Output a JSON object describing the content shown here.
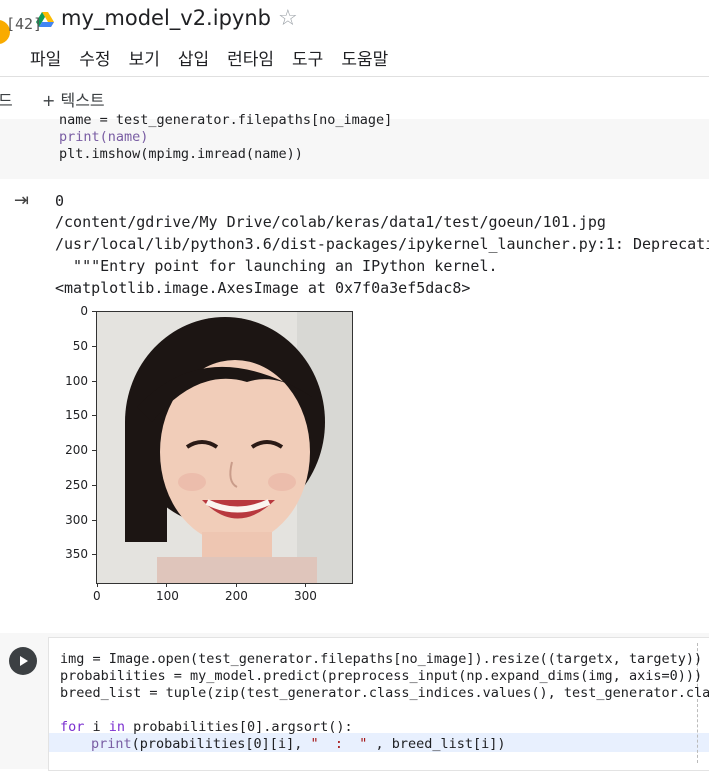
{
  "header": {
    "title": "my_model_v2.ipynb",
    "menu": [
      "파일",
      "수정",
      "보기",
      "삽입",
      "런타임",
      "도구",
      "도움말"
    ]
  },
  "toolbar": {
    "code_btn": "드",
    "text_btn": "+ 텍스트"
  },
  "cell1": {
    "exec_count": "[42]",
    "lines": [
      "name = test_generator.filepaths[no_image]",
      "print(name)",
      "plt.imshow(mpimg.imread(name))"
    ]
  },
  "output": {
    "lines": [
      "0",
      "/content/gdrive/My Drive/colab/keras/data1/test/goeun/101.jpg",
      "/usr/local/lib/python3.6/dist-packages/ipykernel_launcher.py:1: Deprecati",
      "  \"\"\"Entry point for launching an IPython kernel.",
      "<matplotlib.image.AxesImage at 0x7f0a3ef5dac8>"
    ]
  },
  "plot": {
    "y_ticks": [
      "0",
      "50",
      "100",
      "150",
      "200",
      "250",
      "300",
      "350"
    ],
    "x_ticks": [
      "0",
      "100",
      "200",
      "300"
    ]
  },
  "cell2": {
    "line1": "img = Image.open(test_generator.filepaths[no_image]).resize((targetx, targety))",
    "line2": "probabilities = my_model.predict(preprocess_input(np.expand_dims(img, axis=0)))",
    "line3": "breed_list = tuple(zip(test_generator.class_indices.values(), test_generator.class",
    "for_kw": "for",
    "i_var": " i ",
    "in_kw": "in",
    "line5_rest": " probabilities[0].argsort():",
    "print_fn": "print",
    "line6_a": "(probabilities[0][i], ",
    "line6_str": "\"  :  \"",
    "line6_b": " , breed_list[i])"
  },
  "colors": {
    "keyword": "#7b30d0",
    "builtin": "#795da3",
    "string": "#a31515",
    "logo": "#f9ab00"
  }
}
